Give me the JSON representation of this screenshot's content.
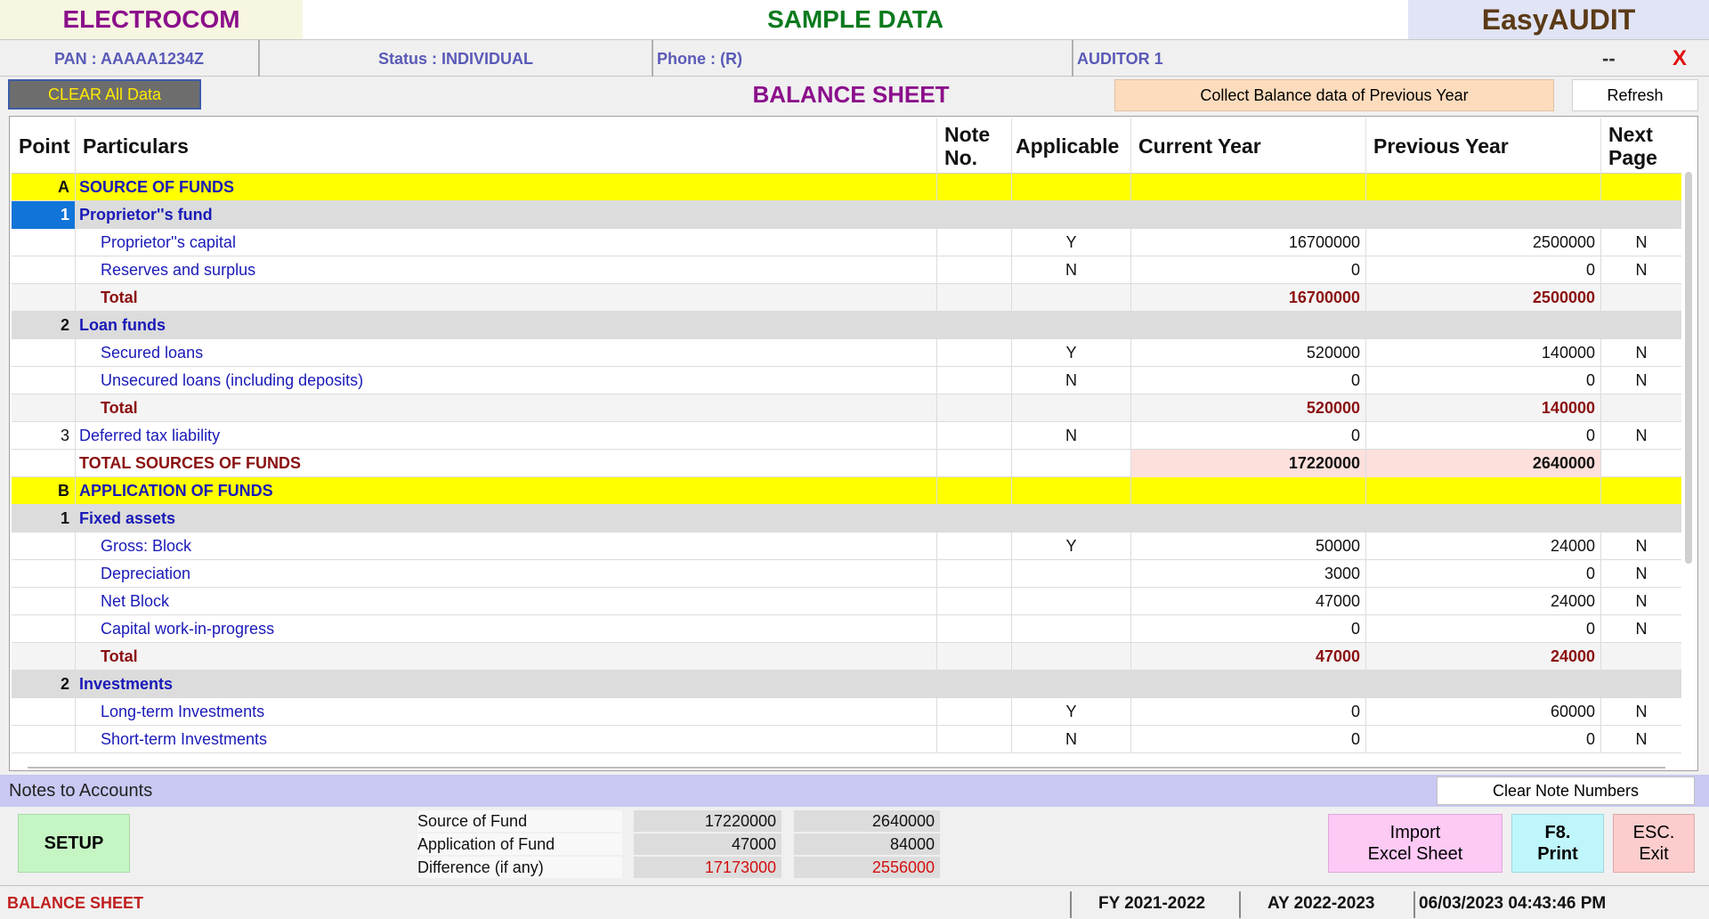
{
  "title": {
    "left": "ELECTROCOM",
    "center": "SAMPLE DATA",
    "right": "EasyAUDIT"
  },
  "info": {
    "pan": "PAN  :  AAAAA1234Z",
    "status": "Status  :  INDIVIDUAL",
    "phone": "Phone  : (R)",
    "auditor": "AUDITOR 1",
    "dash": "--",
    "close": "X"
  },
  "toolbar": {
    "clear_all": "CLEAR All Data",
    "sheet_title": "BALANCE SHEET",
    "collect": "Collect Balance data of Previous Year",
    "refresh": "Refresh"
  },
  "grid": {
    "headers": {
      "point": "Point",
      "particulars": "Particulars",
      "note_line1": "Note",
      "note_line2": "No.",
      "applicable": "Applicable",
      "current": "Current Year",
      "previous": "Previous Year",
      "next_line1": "Next",
      "next_line2": "Page"
    },
    "rows": [
      {
        "kind": "section",
        "point": "A",
        "particulars": "SOURCE OF FUNDS",
        "note": "",
        "applicable": "",
        "current": "",
        "previous": "",
        "next": ""
      },
      {
        "kind": "sub",
        "selected": true,
        "point": "1",
        "particulars": "Proprietor''s fund",
        "note": "",
        "applicable": "",
        "current": "",
        "previous": "",
        "next": ""
      },
      {
        "kind": "item",
        "point": "",
        "particulars": "Proprietor''s capital",
        "note": "",
        "applicable": "Y",
        "current": "16700000",
        "previous": "2500000",
        "next": "N"
      },
      {
        "kind": "item",
        "point": "",
        "particulars": "Reserves and surplus",
        "note": "",
        "applicable": "N",
        "current": "0",
        "previous": "0",
        "next": "N"
      },
      {
        "kind": "total",
        "point": "",
        "particulars": "Total",
        "note": "",
        "applicable": "",
        "current": "16700000",
        "previous": "2500000",
        "next": ""
      },
      {
        "kind": "sub",
        "point": "2",
        "particulars": "Loan funds",
        "note": "",
        "applicable": "",
        "current": "",
        "previous": "",
        "next": ""
      },
      {
        "kind": "item",
        "point": "",
        "particulars": "Secured loans",
        "note": "",
        "applicable": "Y",
        "current": "520000",
        "previous": "140000",
        "next": "N"
      },
      {
        "kind": "item",
        "point": "",
        "particulars": "Unsecured loans (including deposits)",
        "note": "",
        "applicable": "N",
        "current": "0",
        "previous": "0",
        "next": "N"
      },
      {
        "kind": "total",
        "point": "",
        "particulars": "Total",
        "note": "",
        "applicable": "",
        "current": "520000",
        "previous": "140000",
        "next": ""
      },
      {
        "kind": "plain",
        "point": "3",
        "particulars": "Deferred tax liability",
        "note": "",
        "applicable": "N",
        "current": "0",
        "previous": "0",
        "next": "N"
      },
      {
        "kind": "grand",
        "point": "",
        "particulars": "TOTAL SOURCES OF FUNDS",
        "note": "",
        "applicable": "",
        "current": "17220000",
        "previous": "2640000",
        "next": ""
      },
      {
        "kind": "section",
        "point": "B",
        "particulars": "APPLICATION OF FUNDS",
        "note": "",
        "applicable": "",
        "current": "",
        "previous": "",
        "next": ""
      },
      {
        "kind": "sub",
        "point": "1",
        "particulars": "Fixed assets",
        "note": "",
        "applicable": "",
        "current": "",
        "previous": "",
        "next": ""
      },
      {
        "kind": "item",
        "point": "",
        "particulars": "Gross: Block",
        "note": "",
        "applicable": "Y",
        "current": "50000",
        "previous": "24000",
        "next": "N"
      },
      {
        "kind": "item",
        "point": "",
        "particulars": "Depreciation",
        "note": "",
        "applicable": "",
        "current": "3000",
        "previous": "0",
        "next": "N"
      },
      {
        "kind": "item",
        "point": "",
        "particulars": "Net Block",
        "note": "",
        "applicable": "",
        "current": "47000",
        "previous": "24000",
        "next": "N"
      },
      {
        "kind": "item",
        "point": "",
        "particulars": "Capital work-in-progress",
        "note": "",
        "applicable": "",
        "current": "0",
        "previous": "0",
        "next": "N"
      },
      {
        "kind": "total",
        "point": "",
        "particulars": "Total",
        "note": "",
        "applicable": "",
        "current": "47000",
        "previous": "24000",
        "next": ""
      },
      {
        "kind": "sub",
        "point": "2",
        "particulars": "Investments",
        "note": "",
        "applicable": "",
        "current": "",
        "previous": "",
        "next": ""
      },
      {
        "kind": "item",
        "point": "",
        "particulars": "Long-term Investments",
        "note": "",
        "applicable": "Y",
        "current": "0",
        "previous": "60000",
        "next": "N"
      },
      {
        "kind": "item",
        "point": "",
        "particulars": "Short-term Investments",
        "note": "",
        "applicable": "N",
        "current": "0",
        "previous": "0",
        "next": "N"
      }
    ]
  },
  "notes": {
    "label": "Notes to Accounts",
    "clear_button": "Clear Note Numbers"
  },
  "bottom": {
    "setup": "SETUP",
    "summary": [
      {
        "label": "Source of Fund",
        "current": "17220000",
        "previous": "2640000",
        "red": false
      },
      {
        "label": "Application of Fund",
        "current": "47000",
        "previous": "84000",
        "red": false
      },
      {
        "label": "Difference (if any)",
        "current": "17173000",
        "previous": "2556000",
        "red": true
      }
    ],
    "import_line1": "Import",
    "import_line2": "Excel Sheet",
    "print_line1": "F8.",
    "print_line2": "Print",
    "exit_line1": "ESC.",
    "exit_line2": "Exit"
  },
  "statusbar": {
    "left": "BALANCE SHEET",
    "fy": "FY 2021-2022",
    "ay": "AY 2022-2023",
    "datetime": "06/03/2023 04:43:46 PM"
  },
  "colors": {
    "section_bg": "#ffff00",
    "sub_bg": "#dcdcdc",
    "link_blue": "#1a1ab8",
    "total_red": "#8b1010",
    "grand_bg": "#fde0dc",
    "selected_bg": "#1174d8"
  }
}
